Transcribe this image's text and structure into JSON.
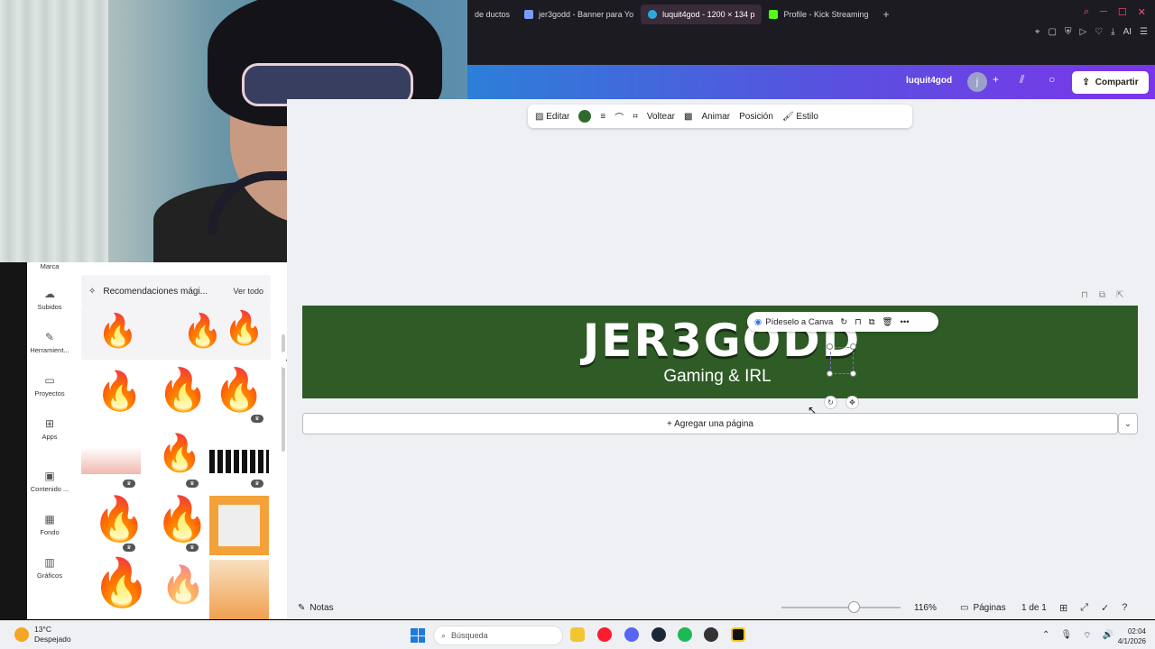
{
  "browser": {
    "tabs": [
      {
        "label": "de ductos",
        "active": false
      },
      {
        "label": "jer3godd - Banner para Yo",
        "active": false
      },
      {
        "label": "luquit4god - 1200 × 134 p",
        "active": true
      },
      {
        "label": "Profile - Kick Streaming",
        "active": false
      }
    ],
    "new_tab": "+",
    "ai_label": "AI"
  },
  "header": {
    "user": "luquit4god",
    "avatar_initial": "j",
    "share_label": "Compartir"
  },
  "context_toolbar": {
    "edit": "Editar",
    "flip": "Voltear",
    "animate": "Animar",
    "position": "Posición",
    "style": "Estilo",
    "color": "#2e6b2b"
  },
  "canvas": {
    "title": "JER3GODD",
    "subtitle": "Gaming & IRL",
    "background": "#2e5b26",
    "float_bar_label": "Pídeselo a Canva"
  },
  "add_page": "+ Agregar una página",
  "bottom": {
    "notes": "Notas",
    "zoom": "116%",
    "pages_label": "Páginas",
    "page_counter": "1 de 1"
  },
  "sidebar": {
    "items": [
      {
        "label": "Marca",
        "icon": "brand-icon"
      },
      {
        "label": "Subidos",
        "icon": "cloud-upload-icon"
      },
      {
        "label": "Herramient...",
        "icon": "pen-icon"
      },
      {
        "label": "Proyectos",
        "icon": "folder-icon"
      },
      {
        "label": "Apps",
        "icon": "apps-grid-icon"
      },
      {
        "label": "Contenido ...",
        "icon": "image-icon"
      },
      {
        "label": "Fondo",
        "icon": "pattern-icon"
      },
      {
        "label": "Gráficos",
        "icon": "chart-icon"
      }
    ]
  },
  "panel": {
    "title": "Recomendaciones mági...",
    "see_all": "Ver todo"
  },
  "taskbar": {
    "temperature": "13°C",
    "weather": "Despejado",
    "search_placeholder": "Búsqueda",
    "time": "02:04",
    "date": "4/1/2026"
  }
}
